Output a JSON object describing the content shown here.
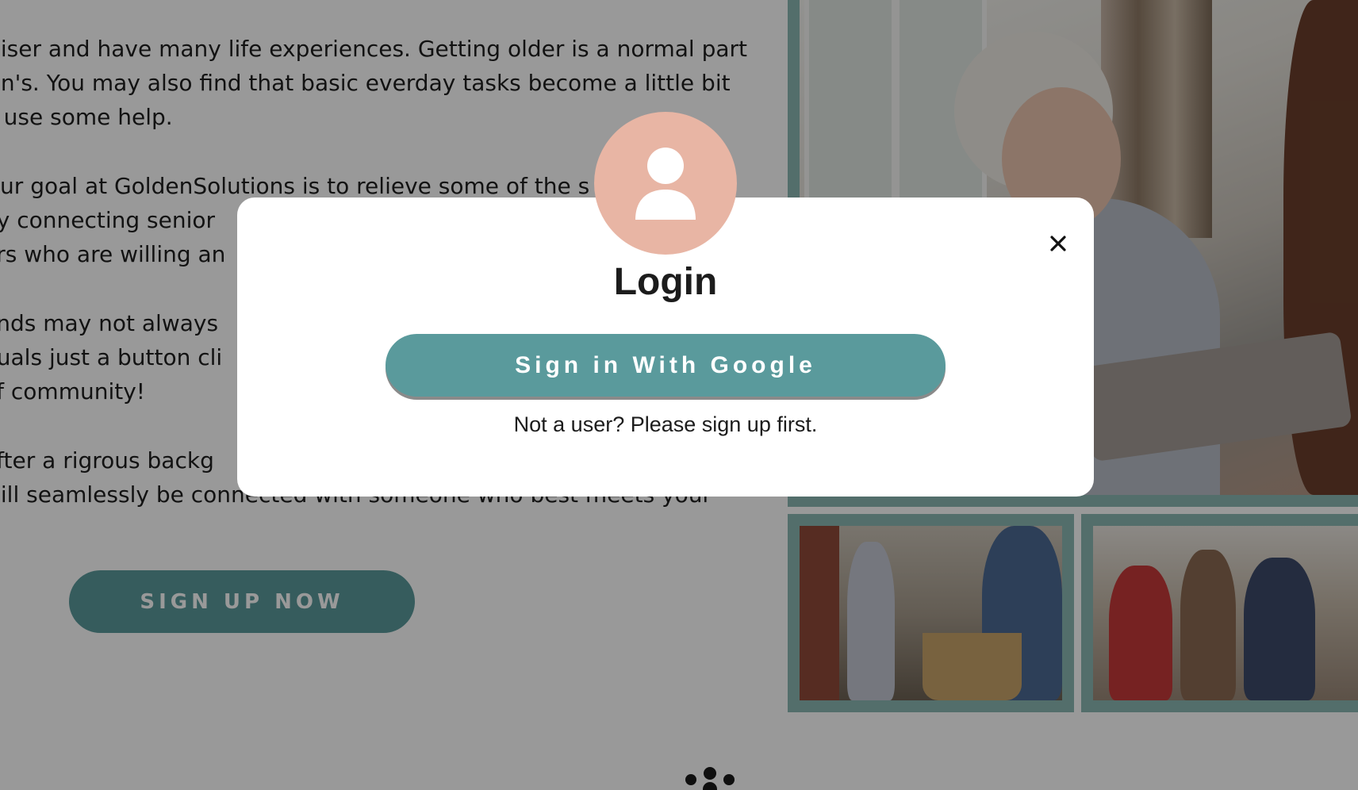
{
  "content": {
    "paragraph_1": [
      "wiser and have many life experiences. Getting older is a normal part",
      "wn's. You may also find that basic everday tasks become a little bit",
      "d use some help."
    ],
    "paragraph_2": [
      "Our goal at GoldenSolutions is to relieve some of the s",
      "by connecting senior",
      "ers who are willing an"
    ],
    "paragraph_3": [
      "ends may not always",
      "duals just a button cli",
      "of community!"
    ],
    "paragraph_4": [
      "after a rigrous backg",
      "will seamlessly be connected with someone who best meets your"
    ],
    "signup_button_label": "SIGN UP NOW"
  },
  "login_modal": {
    "title": "Login",
    "google_button_label": "Sign in With Google",
    "signup_hint": "Not a user? Please sign up first.",
    "close_icon": "close-icon",
    "avatar_icon": "user-icon"
  },
  "colors": {
    "accent_teal": "#5a9a9c",
    "avatar_bg": "#e8b5a4",
    "overlay": "rgba(0,0,0,0.40)"
  }
}
